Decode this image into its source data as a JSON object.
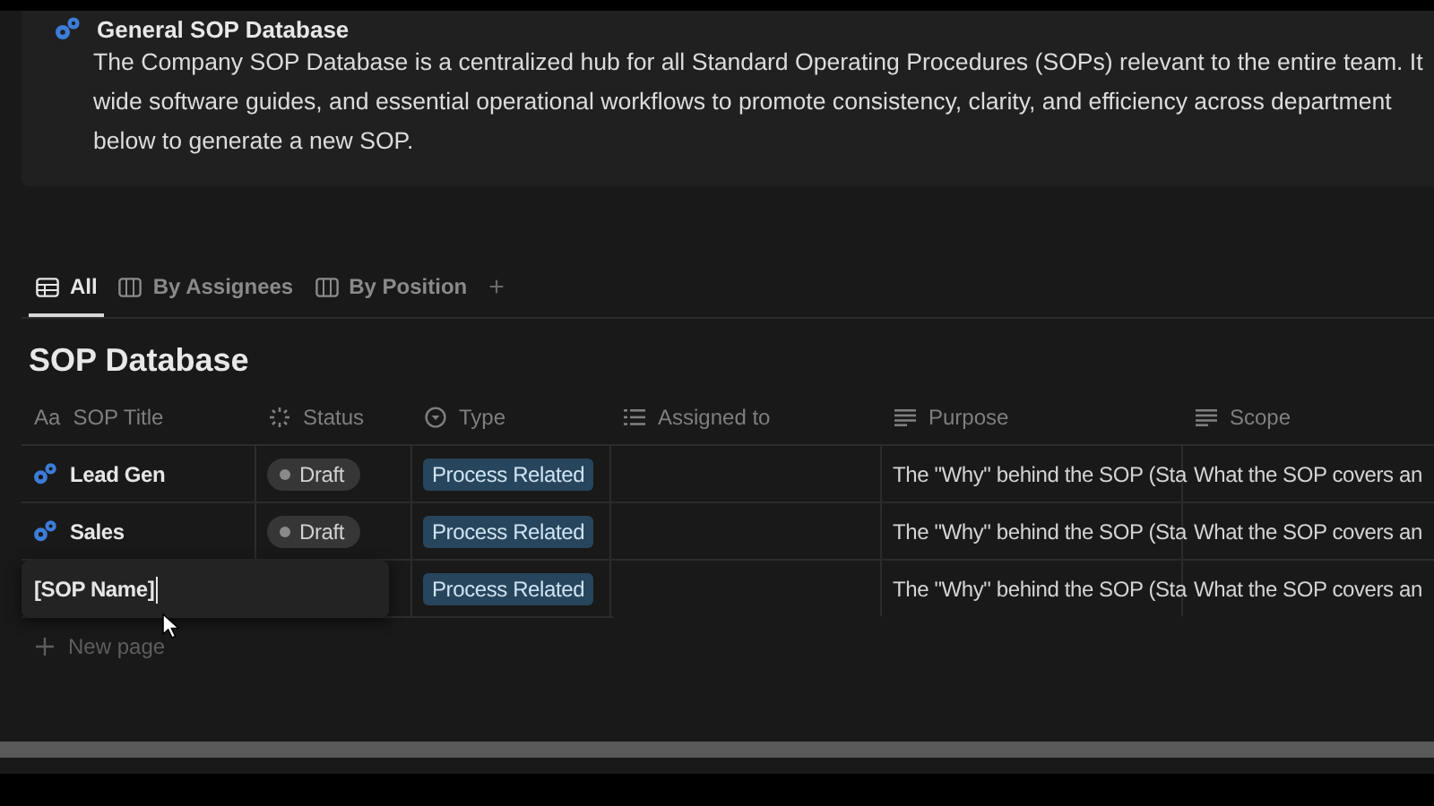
{
  "callout": {
    "title": "General SOP Database",
    "lines": [
      "The Company SOP Database is a centralized hub for all Standard Operating Procedures (SOPs) relevant to the entire team. It",
      "wide software guides, and essential operational workflows to promote consistency, clarity, and efficiency across department",
      "below to generate a new SOP."
    ]
  },
  "tabs": [
    {
      "label": "All",
      "kind": "table",
      "selected": true
    },
    {
      "label": "By Assignees",
      "kind": "board",
      "selected": false
    },
    {
      "label": "By Position",
      "kind": "board",
      "selected": false
    }
  ],
  "add_view": "+",
  "database": {
    "title": "SOP Database",
    "columns": [
      {
        "label": "SOP Title",
        "kind": "title",
        "icon_text": "Aa"
      },
      {
        "label": "Status",
        "kind": "status"
      },
      {
        "label": "Type",
        "kind": "select"
      },
      {
        "label": "Assigned to",
        "kind": "list"
      },
      {
        "label": "Purpose",
        "kind": "text"
      },
      {
        "label": "Scope",
        "kind": "text"
      }
    ],
    "rows": [
      {
        "title": "Lead Gen",
        "editing": false,
        "status": "Draft",
        "type": "Process Related",
        "purpose": "The \"Why\" behind the SOP (Sta",
        "scope": "What the SOP covers an"
      },
      {
        "title": "Sales",
        "editing": false,
        "status": "Draft",
        "type": "Process Related",
        "purpose": "The \"Why\" behind the SOP (Sta",
        "scope": "What the SOP covers an"
      },
      {
        "title": "[SOP Name]",
        "editing": true,
        "type": "Process Related",
        "purpose": "The \"Why\" behind the SOP (Sta",
        "scope": "What the SOP covers an"
      }
    ],
    "new_page": "New page"
  }
}
